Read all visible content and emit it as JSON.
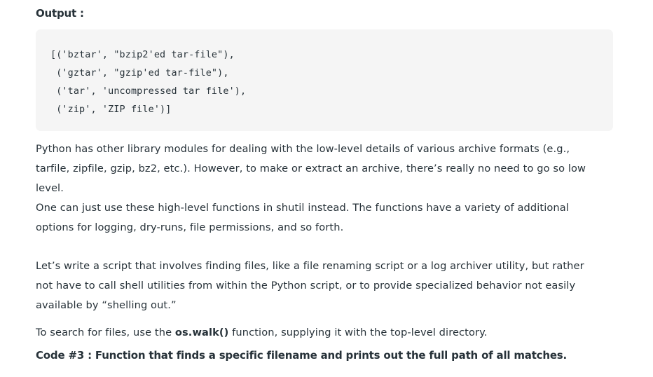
{
  "output_heading": "Output :",
  "code_block": {
    "lines": [
      "[('bztar', \"bzip2'ed tar-file\"),",
      " ('gztar', \"gzip'ed tar-file\"),",
      " ('tar', 'uncompressed tar file'),",
      " ('zip', 'ZIP file')]"
    ]
  },
  "paragraph1": {
    "lines": [
      "Python has other library modules for dealing with the low-level details of various archive formats (e.g.,",
      "tarfile, zipfile, gzip, bz2, etc.). However, to make or extract an archive, there’s really no need to go so low",
      "level.",
      "One can just use these high-level functions in shutil instead. The functions have a variety of additional",
      "options for logging, dry-runs, file permissions, and so forth."
    ]
  },
  "paragraph2": {
    "lines": [
      "Let’s write a script that involves finding files, like a file renaming script or a log archiver utility, but rather",
      "not have to call shell utilities from within the Python script, or to provide specialized behavior not easily",
      "available by “shelling out.”"
    ]
  },
  "paragraph3": {
    "prefix": "To search for files, use the ",
    "bold": "os.walk()",
    "suffix": " function, supplying it with the top-level directory."
  },
  "code_heading": "Code #3 : Function that finds a specific filename and prints out the full path of all matches."
}
